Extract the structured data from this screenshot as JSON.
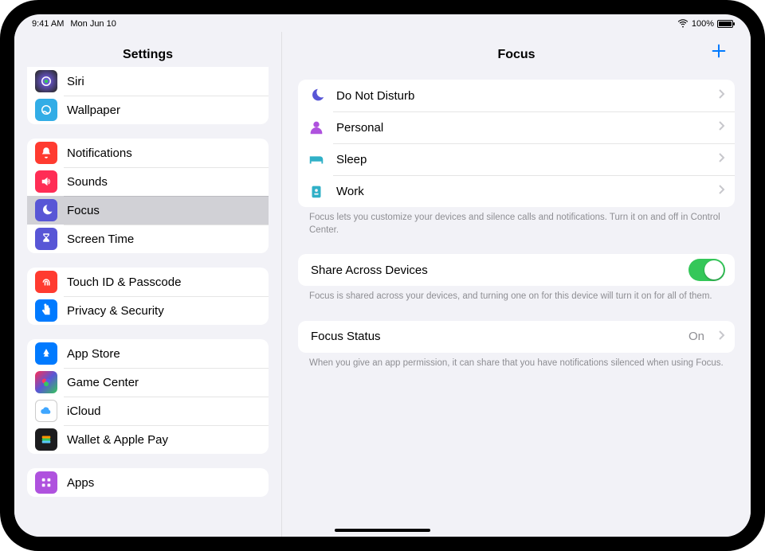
{
  "status": {
    "time": "9:41 AM",
    "date": "Mon Jun 10",
    "battery_pct": "100%"
  },
  "sidebar": {
    "title": "Settings",
    "group_top": [
      {
        "label": "Siri"
      },
      {
        "label": "Wallpaper"
      }
    ],
    "group_alerts": [
      {
        "label": "Notifications"
      },
      {
        "label": "Sounds"
      },
      {
        "label": "Focus",
        "selected": true
      },
      {
        "label": "Screen Time"
      }
    ],
    "group_security": [
      {
        "label": "Touch ID & Passcode"
      },
      {
        "label": "Privacy & Security"
      }
    ],
    "group_store": [
      {
        "label": "App Store"
      },
      {
        "label": "Game Center"
      },
      {
        "label": "iCloud"
      },
      {
        "label": "Wallet & Apple Pay"
      }
    ],
    "group_apps": [
      {
        "label": "Apps"
      }
    ]
  },
  "detail": {
    "title": "Focus",
    "focus_modes": [
      {
        "label": "Do Not Disturb"
      },
      {
        "label": "Personal"
      },
      {
        "label": "Sleep"
      },
      {
        "label": "Work"
      }
    ],
    "focus_footer": "Focus lets you customize your devices and silence calls and notifications. Turn it on and off in Control Center.",
    "share": {
      "label": "Share Across Devices",
      "on": true
    },
    "share_footer": "Focus is shared across your devices, and turning one on for this device will turn it on for all of them.",
    "status": {
      "label": "Focus Status",
      "value": "On"
    },
    "status_footer": "When you give an app permission, it can share that you have notifications silenced when using Focus."
  }
}
